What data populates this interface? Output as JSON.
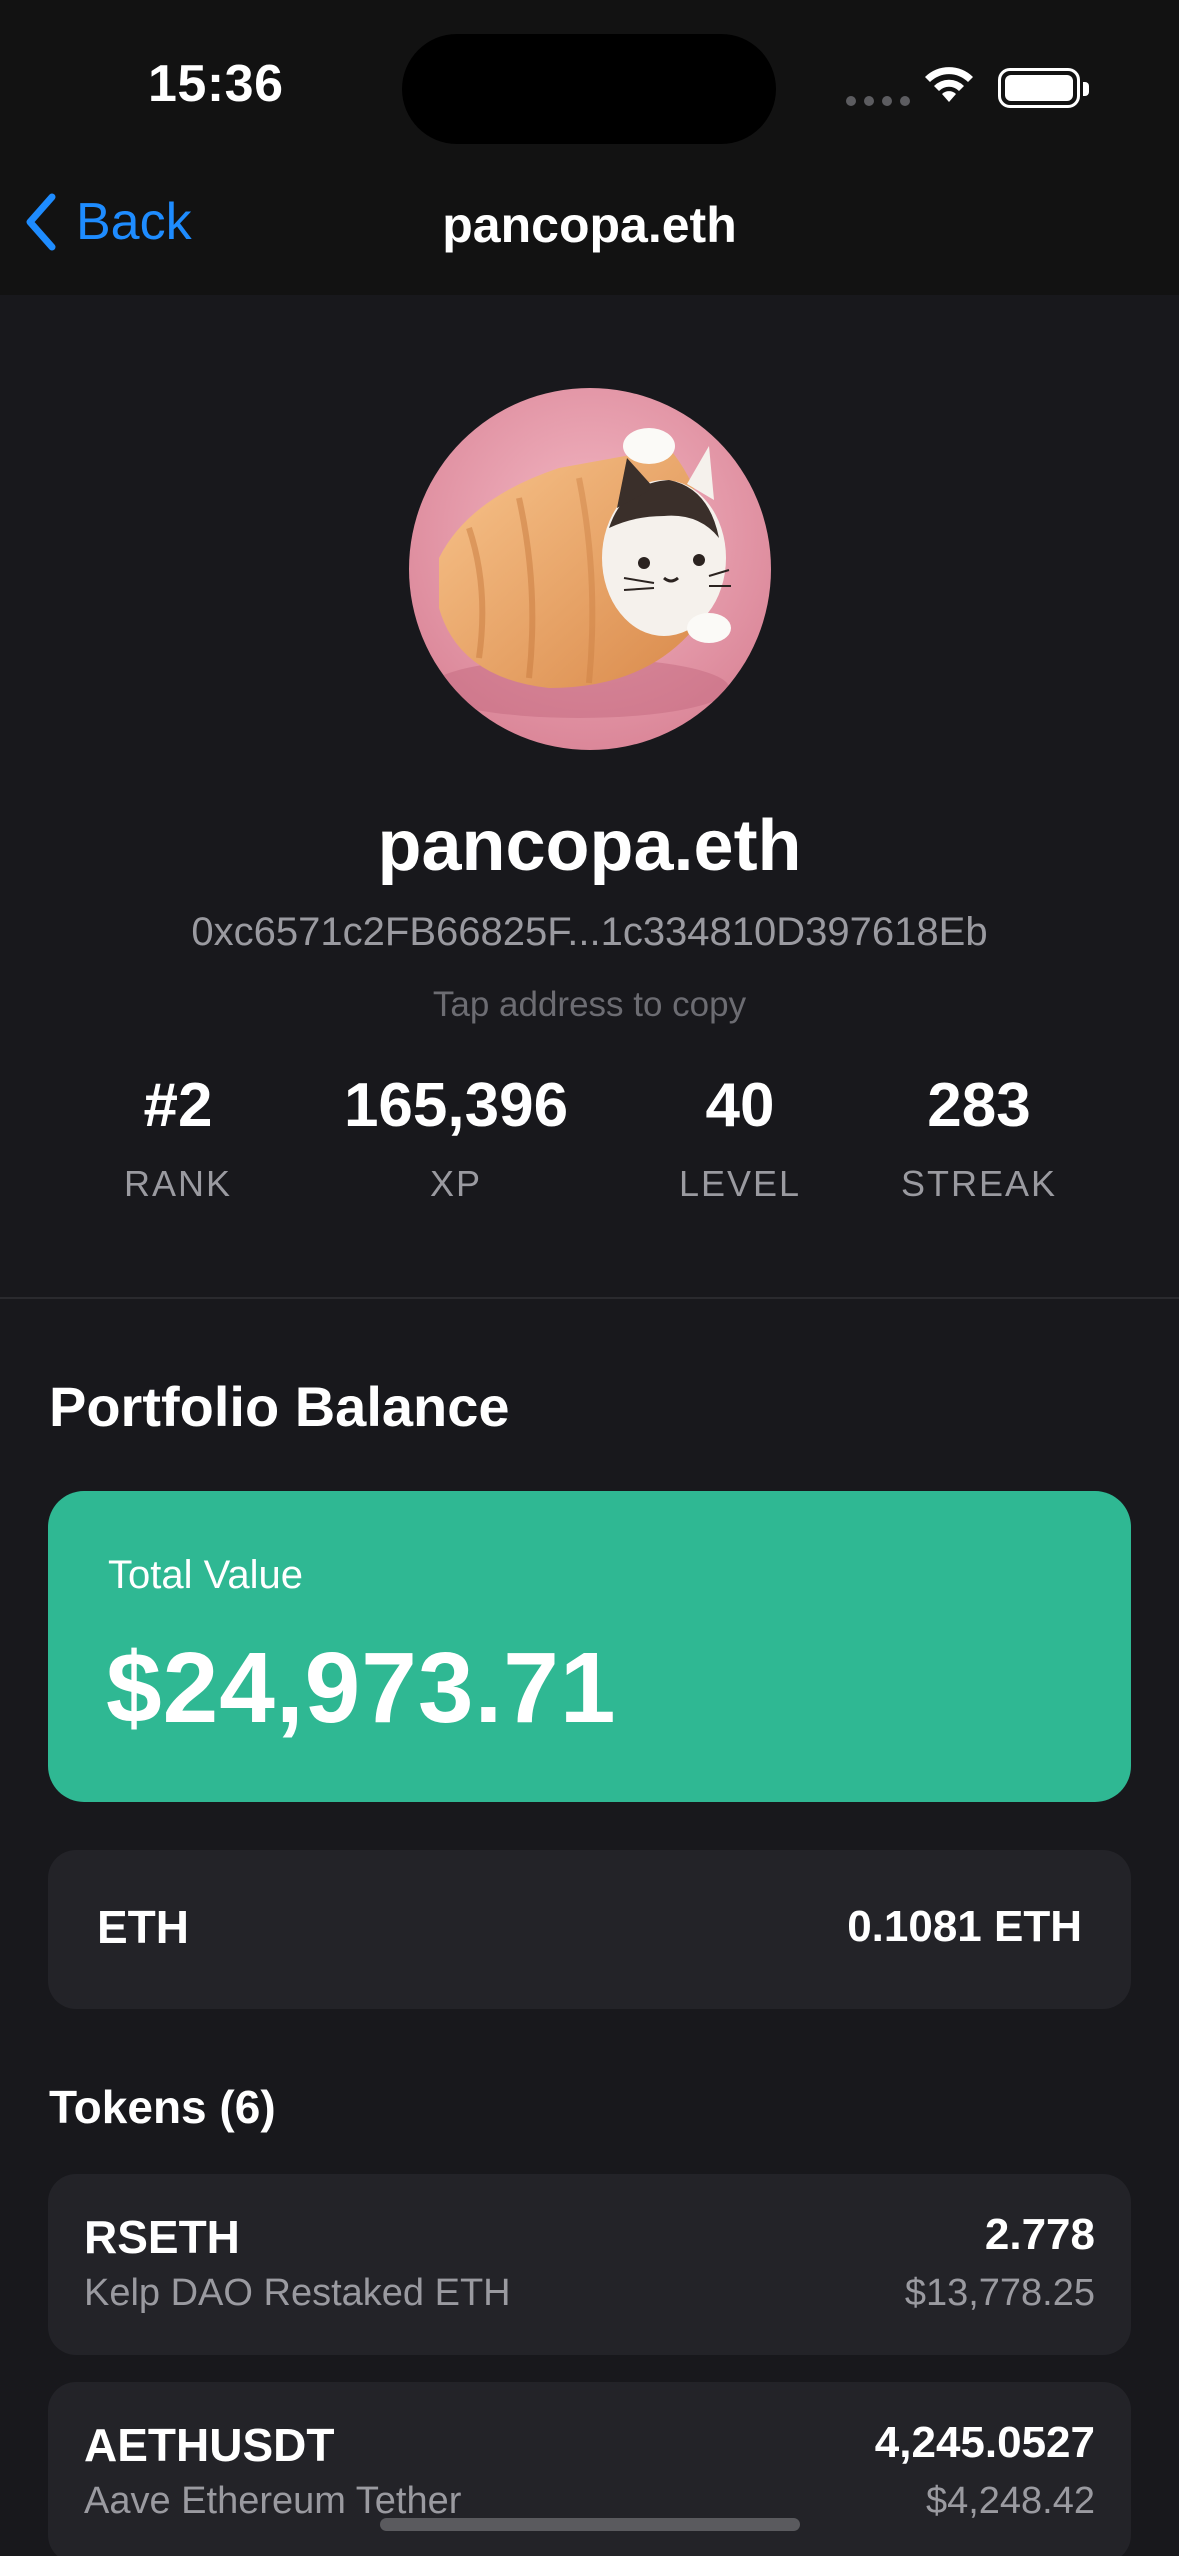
{
  "status_bar": {
    "time": "15:36"
  },
  "nav": {
    "back_label": "Back",
    "title": "pancopa.eth"
  },
  "profile": {
    "ens_name": "pancopa.eth",
    "address": "0xc6571c2FB66825F...1c334810D397618Eb",
    "copy_hint": "Tap address to copy",
    "stats": [
      {
        "value": "#2",
        "label": "RANK"
      },
      {
        "value": "165,396",
        "label": "XP"
      },
      {
        "value": "40",
        "label": "LEVEL"
      },
      {
        "value": "283",
        "label": "STREAK"
      }
    ]
  },
  "portfolio": {
    "title": "Portfolio Balance",
    "total_label": "Total Value",
    "total_value": "$24,973.71",
    "accent_color": "#2fb893",
    "eth": {
      "symbol": "ETH",
      "amount": "0.1081 ETH"
    },
    "tokens_title": "Tokens (6)",
    "tokens": [
      {
        "symbol": "RSETH",
        "name": "Kelp DAO Restaked ETH",
        "quantity": "2.778",
        "usd": "$13,778.25"
      },
      {
        "symbol": "AETHUSDT",
        "name": "Aave Ethereum Tether",
        "quantity": "4,245.0527",
        "usd": "$4,248.42"
      }
    ]
  },
  "icons": [
    "chevron-left-icon",
    "wifi-icon",
    "battery-icon",
    "cellular-signal-icon",
    "avatar-cat-image"
  ]
}
